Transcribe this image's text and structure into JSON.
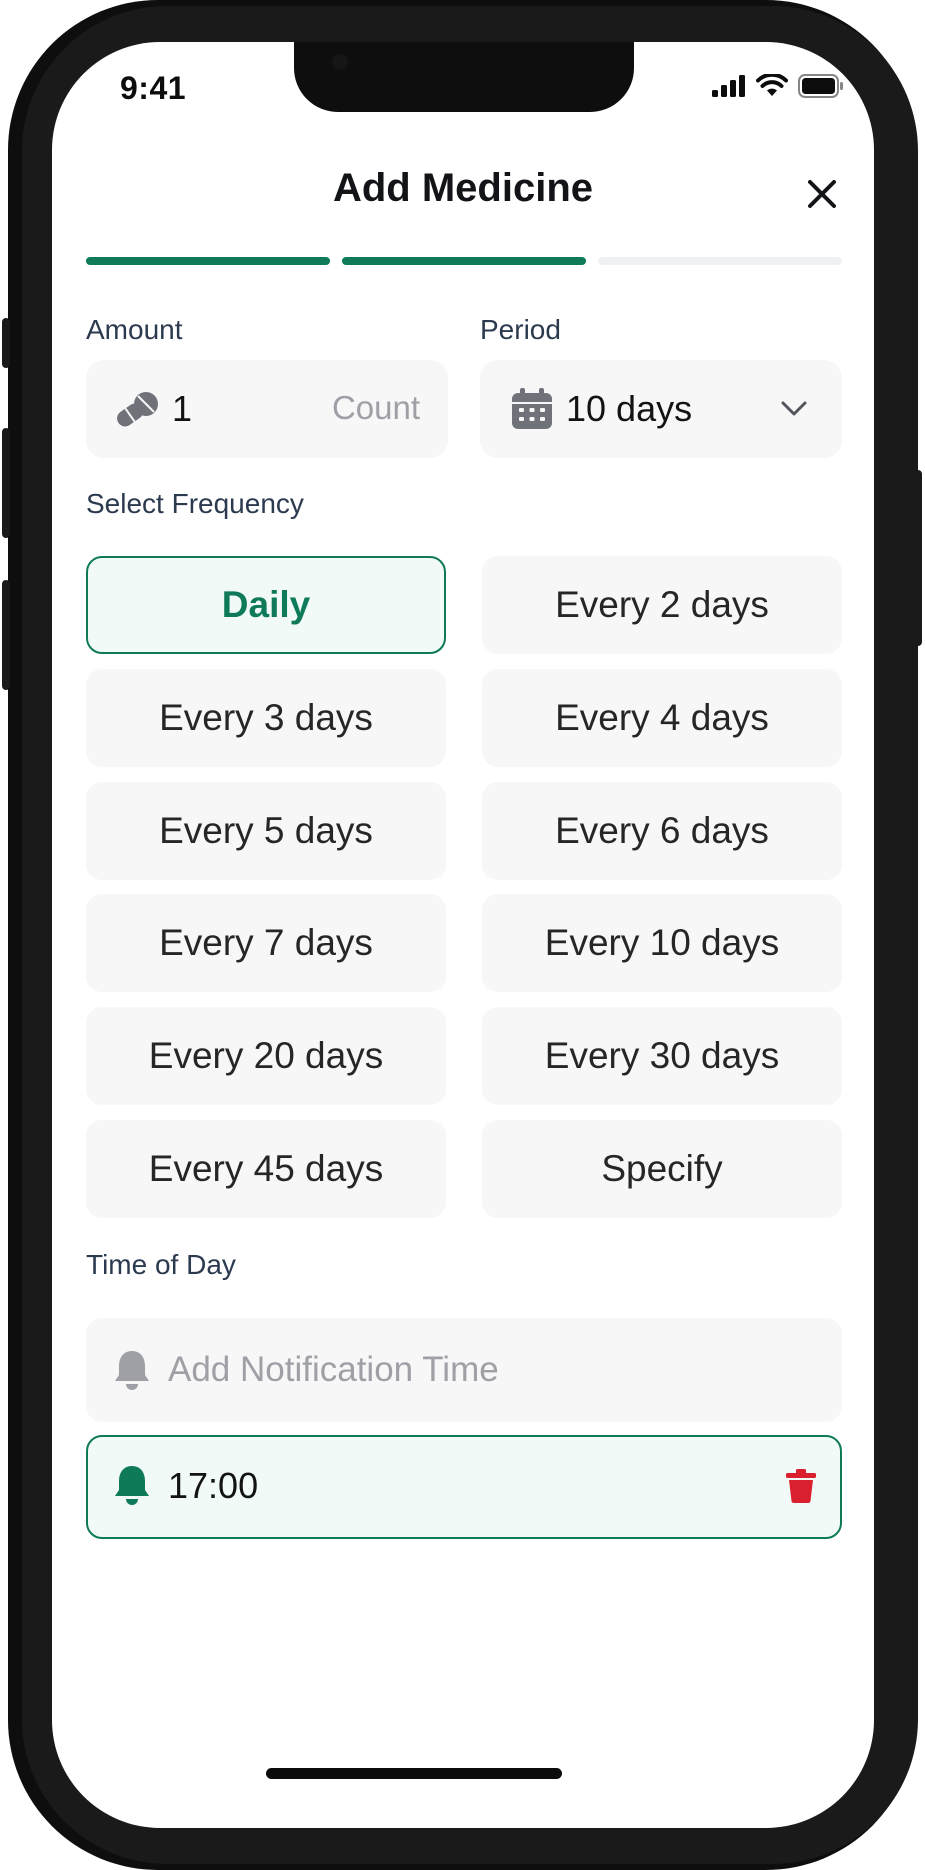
{
  "status_bar": {
    "time": "9:41"
  },
  "header": {
    "title": "Add Medicine"
  },
  "progress": {
    "total_steps": 3,
    "completed_steps": 2
  },
  "amount": {
    "label": "Amount",
    "value": "1",
    "unit": "Count"
  },
  "period": {
    "label": "Period",
    "value": "10 days"
  },
  "frequency": {
    "label": "Select Frequency",
    "selected": "Daily",
    "options": [
      "Daily",
      "Every 2 days",
      "Every 3 days",
      "Every 4 days",
      "Every 5 days",
      "Every 6 days",
      "Every 7 days",
      "Every 10 days",
      "Every 20 days",
      "Every 30 days",
      "Every 45 days",
      "Specify"
    ]
  },
  "time_of_day": {
    "label": "Time of Day",
    "add_placeholder": "Add Notification Time",
    "times": [
      "17:00"
    ]
  },
  "colors": {
    "accent": "#0f7a5a",
    "delete": "#d9202e",
    "muted": "#9ea0a6"
  }
}
